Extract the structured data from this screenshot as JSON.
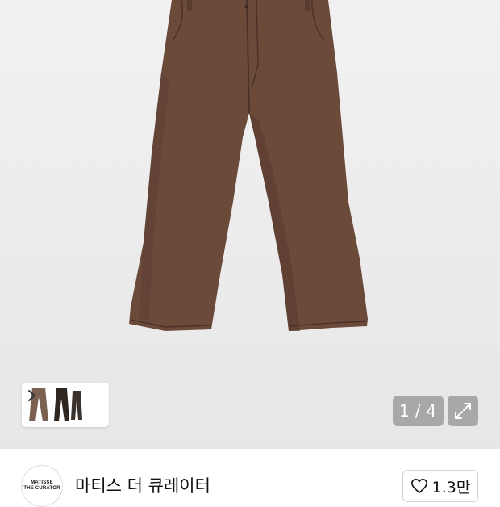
{
  "gallery": {
    "counter_current": "1",
    "counter_total": "4",
    "thumbnail_images": [
      "brown-pants",
      "black-pants",
      "dark-pants"
    ]
  },
  "store": {
    "logo_line1": "MATISSE",
    "logo_line2": "THE CURATOR",
    "name": "마티스 더 큐레이터"
  },
  "like": {
    "count": "1.3만",
    "icon": "heart-outline-icon"
  },
  "colors": {
    "pants_brown": "#6b4a3a",
    "overlay_button": "#969696"
  }
}
